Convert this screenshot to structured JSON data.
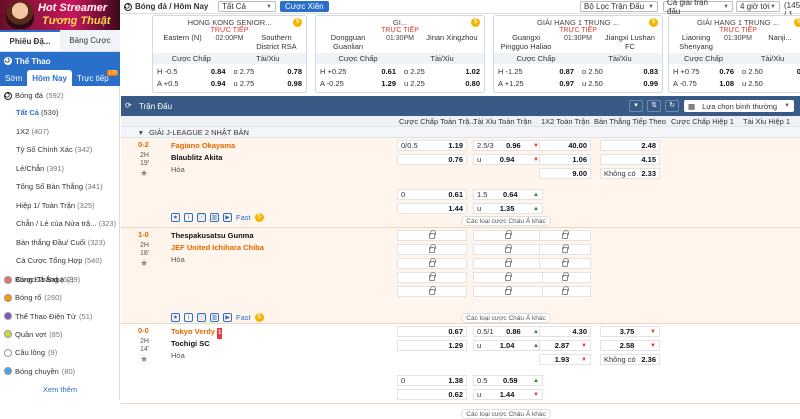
{
  "banner": {
    "line1": "Hot Streamer",
    "line2": "Tương Thuật"
  },
  "filter": {
    "title": "Bóng đá / Hôm Nay",
    "select_all": "Tất Cả",
    "live_button": "Cược Xiên",
    "tournament": "Bộ Lọc Trận Đấu",
    "odds": "Cả giải trận đấu",
    "time": "4 giờ tới",
    "count": "(145 / 1"
  },
  "cards": [
    {
      "league": "HONG KONG SENIOR...",
      "home": "Eastern (N)",
      "away": "Southern District RSA",
      "tag": "TRỰC TIẾP",
      "time": "02:00PM",
      "h1": "-0.5",
      "hv1": "0.84",
      "h2": "o 2.75",
      "hv2": "0.78",
      "a1": "+0.5",
      "av1": "0.94",
      "a2": "u 2.75",
      "av2": "0.98"
    },
    {
      "league": "GI...",
      "home": "Dongguan Guanlian",
      "away": "Jinan Xingzhou",
      "tag": "TRỰC TIẾP",
      "time": "01:30PM",
      "h1": "+0.25",
      "hv1": "0.61",
      "h2": "o 2.25",
      "hv2": "1.02",
      "a1": "-0.25",
      "av1": "1.29",
      "a2": "u 2.25",
      "av2": "0.80"
    },
    {
      "league": "GIẢI HẠNG 1 TRUNG ...",
      "home": "Guangxi Pingguo Haliao",
      "away": "Jiangxi Lushan FC",
      "tag": "TRỰC TIẾP",
      "time": "01:30PM",
      "h1": "-1.25",
      "hv1": "0.87",
      "h2": "o 2.50",
      "hv2": "0.83",
      "a1": "+1.25",
      "av1": "0.97",
      "a2": "u 2.50",
      "av2": "0.99"
    },
    {
      "league": "GIẢI HẠNG 1 TRUNG ...",
      "home": "Liaoning Shenyang Urban",
      "away": "Nanji...",
      "tag": "TRỰC TIẾP",
      "time": "01:30PM",
      "h1": "+0.75",
      "hv1": "0.76",
      "h2": "o 2.50",
      "hv2": "0.",
      "a1": "-0.75",
      "av1": "1.08",
      "a2": "u 2.50",
      "av2": ""
    }
  ],
  "card_head": {
    "handicap": "Cược Chấp",
    "ou": "Tài/Xỉu"
  },
  "sidebar": {
    "tab_a": "Phiếu Đặ...",
    "tab_b": "Bảng Cược",
    "sport_head": "Thể Thao",
    "period": [
      "Sớm",
      "Hôm Nay",
      "Trực tiếp"
    ],
    "period_badge": "120",
    "football": "Bóng đá",
    "football_count": "(592)",
    "subs": [
      {
        "label": "Tất Cả",
        "count": "(530)"
      },
      {
        "label": "1X2",
        "count": "(407)"
      },
      {
        "label": "Tỷ Số Chính Xác",
        "count": "(342)"
      },
      {
        "label": "Lẻ/Chẵn",
        "count": "(391)"
      },
      {
        "label": "Tổng Số Bàn Thắng",
        "count": "(341)"
      },
      {
        "label": "Hiệp 1/ Toàn Trận",
        "count": "(325)"
      },
      {
        "label": "Chẵn / Lẻ của Nửa trậ...",
        "count": "(323)"
      },
      {
        "label": "Bàn thắng Đầu/ Cuối",
        "count": "(323)"
      },
      {
        "label": "Cá Cược Tổng Hợp",
        "count": "(540)"
      },
      {
        "label": "Cược Thắng",
        "count": "(62)"
      }
    ],
    "sports": [
      {
        "label": "Bóng Đá Saba",
        "count": "(39)",
        "color": "#e57373"
      },
      {
        "label": "Bóng rổ",
        "count": "(260)",
        "color": "#ff9800"
      },
      {
        "label": "Thể Thao Điện Tử",
        "count": "(51)",
        "color": "#7e57c2"
      },
      {
        "label": "Quần vợt",
        "count": "(85)",
        "color": "#cddc39"
      },
      {
        "label": "Cầu lông",
        "count": "(9)",
        "color": "#ffffff"
      },
      {
        "label": "Bóng chuyền",
        "count": "(80)",
        "color": "#42a5f5"
      }
    ],
    "more": "Xem thêm"
  },
  "main": {
    "title": "Trận Đấu",
    "view": "Lựa chọn bình thường",
    "cols": [
      "Cược Chấp Toàn Trậ...",
      "Tài Xỉu Toàn Trận",
      "1X2 Toàn Trận",
      "Bàn Thắng Tiếp Theo",
      "Cược Chấp Hiệp 1",
      "Tài Xỉu Hiệp 1"
    ],
    "league": "GIẢI J-LEAGUE 2 NHẬT BẢN",
    "draw": "Hòa",
    "more_bets": "Các loại cược Châu Á khác",
    "fast": "Fast",
    "none": "Không có",
    "matches": [
      {
        "score": "0-2",
        "half": "2H",
        "min": "19'",
        "home": "Fagiano Okayama",
        "away": "Blaublitz Akita",
        "hc": [
          "0/0.5",
          "1.19",
          "",
          "0.76"
        ],
        "ou": [
          "2.5/3",
          "0.96",
          "u",
          "0.94"
        ],
        "x12": [
          "40.00",
          "1.06",
          "9.00"
        ],
        "next": [
          "2.48",
          "4.15",
          "2.33"
        ],
        "hc2": [
          "0",
          "0.61",
          "",
          "1.44"
        ],
        "ou2": [
          "1.5",
          "0.64",
          "u",
          "1.35"
        ]
      },
      {
        "score": "1-0",
        "half": "2H",
        "min": "18'",
        "home": "Thespakusatsu Gunma",
        "away": "JEF United Ichihara Chiba"
      },
      {
        "score": "0-0",
        "half": "2H",
        "min": "14'",
        "home": "Tokyo Verdy",
        "away": "Tochigi SC",
        "red": "1",
        "hc": [
          "",
          "0.67",
          "",
          "1.29"
        ],
        "ou": [
          "0.5/1",
          "0.86",
          "u",
          "1.04"
        ],
        "x12": [
          "4.30",
          "2.87",
          "1.93"
        ],
        "next": [
          "3.75",
          "2.58",
          "2.36"
        ],
        "hc2": [
          "0",
          "1.38",
          "",
          "0.62"
        ],
        "ou2": [
          "0.5",
          "0.59",
          "u",
          "1.44"
        ]
      }
    ]
  }
}
